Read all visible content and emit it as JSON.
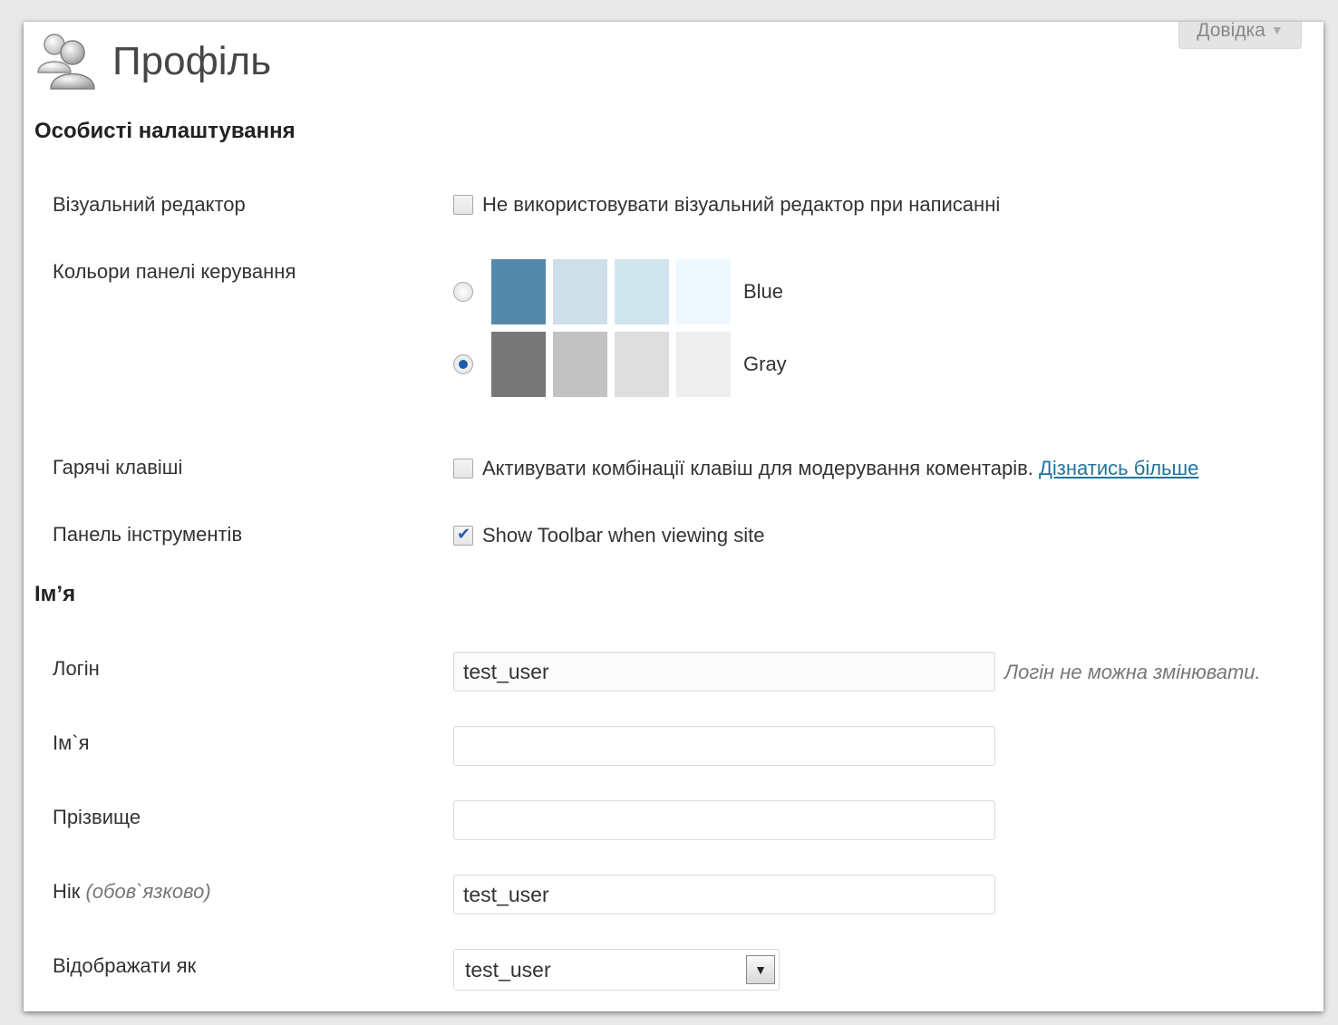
{
  "help_tab": {
    "label": "Довідка"
  },
  "page": {
    "title": "Профіль",
    "icon": "users-icon"
  },
  "personal": {
    "heading": "Особисті налаштування",
    "visual_editor": {
      "label": "Візуальний редактор",
      "checkbox_text": "Не використовувати візуальний редактор при написанні",
      "checked": false
    },
    "admin_colors": {
      "label": "Кольори панелі керування",
      "schemes": [
        {
          "name": "Blue",
          "selected": false,
          "colors": [
            "#5589aa",
            "#cfdfe9",
            "#d1e5ee",
            "#eff8ff"
          ]
        },
        {
          "name": "Gray",
          "selected": true,
          "colors": [
            "#777777",
            "#c2c2c2",
            "#dddddd",
            "#eeeeee"
          ]
        }
      ]
    },
    "shortcuts": {
      "label": "Гарячі клавіші",
      "checkbox_text": "Активувати комбінації клавіш для модерування коментарів.",
      "link_text": "Дізнатись більше",
      "checked": false
    },
    "toolbar": {
      "label": "Панель інструментів",
      "checkbox_text": "Show Toolbar when viewing site",
      "checked": true
    }
  },
  "name": {
    "heading": "Ім’я",
    "login": {
      "label": "Логін",
      "value": "test_user",
      "description": "Логін не можна змінювати."
    },
    "first_name": {
      "label": "Ім`я",
      "value": ""
    },
    "last_name": {
      "label": "Прізвище",
      "value": ""
    },
    "nickname": {
      "label": "Нік",
      "hint": "(обов`язково)",
      "value": "test_user"
    },
    "display_name": {
      "label": "Відображати як",
      "value": "test_user"
    }
  }
}
